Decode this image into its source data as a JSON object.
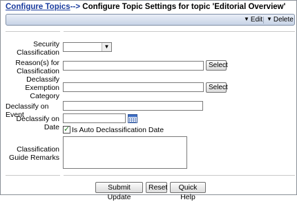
{
  "header": {
    "link_label": "Configure Topics",
    "separator": "-->",
    "title": "Configure Topic Settings for topic 'Editorial Overview'"
  },
  "toolbar": {
    "edit_label": "Edit",
    "delete_label": "Delete"
  },
  "form": {
    "security_classification_label": "Security Classification",
    "security_classification_value": "",
    "reasons_label": "Reason(s) for Classification",
    "reasons_value": "",
    "declassify_exemption_label": "Declassify Exemption Category",
    "declassify_exemption_value": "",
    "declassify_event_label": "Declassify on Event",
    "declassify_event_value": "",
    "declassify_date_label": "Declassify on Date",
    "declassify_date_value": "",
    "auto_declass_label": "Is Auto Declassification Date",
    "auto_declass_checked": true,
    "guide_remarks_label": "Classification Guide Remarks",
    "guide_remarks_value": "",
    "select_button_label": "Select"
  },
  "actions": {
    "submit_label": "Submit Update",
    "reset_label": "Reset",
    "help_label": "Quick Help"
  },
  "icons": {
    "dropdown": "chevron-down-icon",
    "calendar": "calendar-icon",
    "toolbar_menu": "chevron-down-icon"
  },
  "colors": {
    "link": "#1a3c9e",
    "toolbar_top": "#e9eef7",
    "toolbar_bottom": "#c7d3e6",
    "checkmark": "#1f7a1f"
  }
}
